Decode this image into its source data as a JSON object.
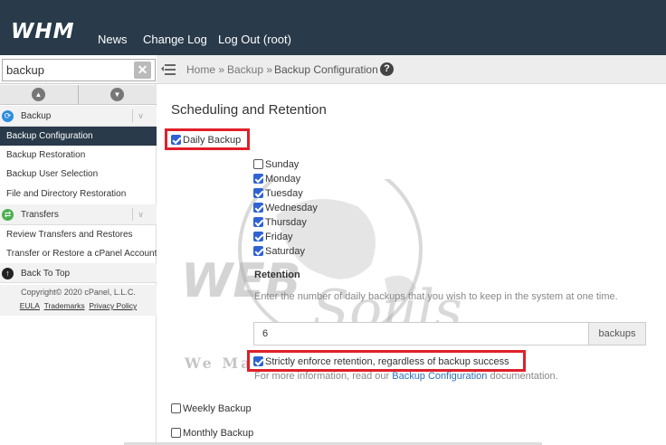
{
  "header": {
    "logo": "WHM",
    "nav": [
      "News",
      "Change Log",
      "Log Out (root)"
    ]
  },
  "sidebar": {
    "search_value": "backup",
    "clear_symbol": "✕",
    "sections": [
      {
        "label": "Backup",
        "icon": "backup-icon",
        "items": [
          "Backup Configuration",
          "Backup Restoration",
          "Backup User Selection",
          "File and Directory Restoration"
        ]
      },
      {
        "label": "Transfers",
        "icon": "transfers-icon",
        "items": [
          "Review Transfers and Restores",
          "Transfer or Restore a cPanel Account"
        ]
      }
    ],
    "back_to_top": "Back To Top",
    "copyright": "Copyright© 2020 cPanel, L.L.C.",
    "footer_links": [
      "EULA",
      "Trademarks",
      "Privacy Policy"
    ],
    "active_item": "Backup Configuration"
  },
  "breadcrumb": {
    "home": "Home »",
    "backup": "Backup »",
    "current": "Backup Configuration",
    "help": "?"
  },
  "main": {
    "title": "Scheduling and Retention",
    "daily_backup": {
      "label": "Daily Backup",
      "checked": true
    },
    "days": [
      {
        "label": "Sunday",
        "checked": false
      },
      {
        "label": "Monday",
        "checked": true
      },
      {
        "label": "Tuesday",
        "checked": true
      },
      {
        "label": "Wednesday",
        "checked": true
      },
      {
        "label": "Thursday",
        "checked": true
      },
      {
        "label": "Friday",
        "checked": true
      },
      {
        "label": "Saturday",
        "checked": true
      }
    ],
    "retention_heading": "Retention",
    "retention_desc": "Enter the number of daily backups that you wish to keep in the system at one time.",
    "retention_value": "6",
    "retention_unit": "backups",
    "strict": {
      "label": "Strictly enforce retention, regardless of backup success",
      "checked": true
    },
    "info_prefix": "For more information, read our",
    "info_link": "Backup Configuration",
    "info_suffix": "documentation.",
    "weekly_backup": {
      "label": "Weekly Backup",
      "checked": false
    },
    "monthly_backup": {
      "label": "Monthly Backup",
      "checked": false
    }
  },
  "watermark": {
    "brand_web": "WEB",
    "brand_souls": "Souls",
    "tagline": "We Ma"
  },
  "colors": {
    "topbar": "#293a4a",
    "highlight": "#e0202a",
    "link": "#2a6fb8",
    "checkbox": "#2f63d4"
  }
}
